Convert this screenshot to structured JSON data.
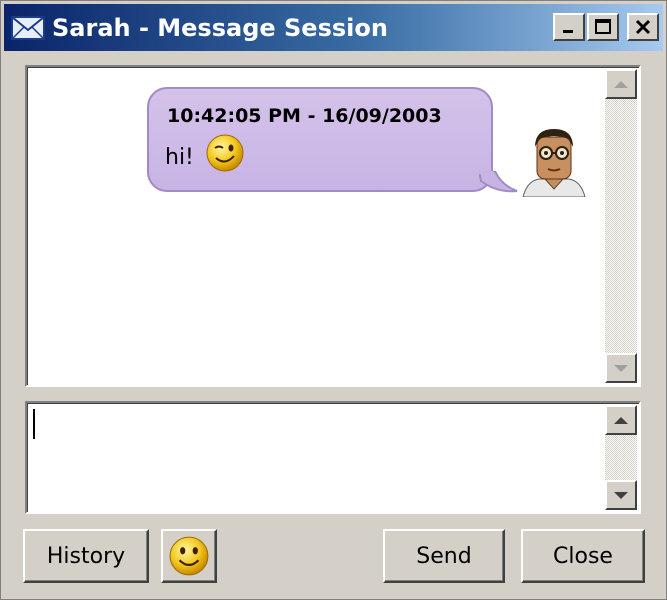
{
  "window": {
    "title": "Sarah - Message Session",
    "controls": {
      "minimize": "_",
      "maximize": "□",
      "close": "✕"
    }
  },
  "chat": {
    "messages": [
      {
        "timestamp": "10:42:05 PM - 16/09/2003",
        "text": "hi!",
        "emoticon": "wink-emoticon"
      }
    ]
  },
  "input": {
    "value": ""
  },
  "buttons": {
    "history": "History",
    "send": "Send",
    "close": "Close",
    "emoticon_icon": "smiley-icon"
  },
  "colors": {
    "titlebar_start": "#0a246a",
    "titlebar_end": "#a6caf0",
    "bubble": "#c8b4e4",
    "window_bg": "#d4d0c8"
  }
}
